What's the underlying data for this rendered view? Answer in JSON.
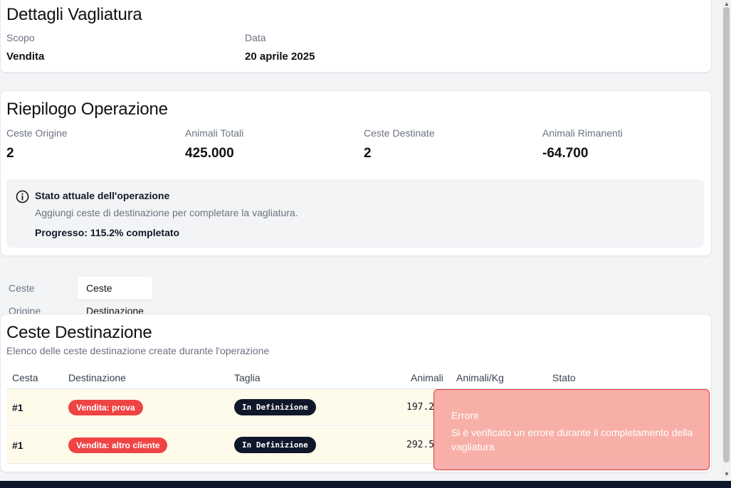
{
  "details": {
    "title": "Dettagli Vagliatura",
    "scope_label": "Scopo",
    "scope_value": "Vendita",
    "date_label": "Data",
    "date_value": "20 aprile 2025"
  },
  "summary": {
    "title": "Riepilogo Operazione",
    "stats": [
      {
        "label": "Ceste Origine",
        "value": "2"
      },
      {
        "label": "Animali Totali",
        "value": "425.000"
      },
      {
        "label": "Ceste Destinate",
        "value": "2"
      },
      {
        "label": "Animali Rimanenti",
        "value": "-64.700"
      }
    ],
    "info": {
      "icon": "info-icon",
      "title": "Stato attuale dell'operazione",
      "description": "Aggiungi ceste di destinazione per completare la vagliatura.",
      "progress": "Progresso: 115.2% completato"
    }
  },
  "tabs": [
    {
      "label": "Ceste Origine",
      "active": false
    },
    {
      "label": "Ceste Destinazione",
      "active": true
    }
  ],
  "destinations": {
    "title": "Ceste Destinazione",
    "subtitle": "Elenco delle ceste destinazione create durante l'operazione",
    "columns": [
      "Cesta",
      "Destinazione",
      "Taglia",
      "Animali",
      "Animali/Kg",
      "Stato"
    ],
    "rows": [
      {
        "cesta": "#1",
        "destinazione": "Vendita: prova",
        "taglia": "In Definizione",
        "animali": "197.2"
      },
      {
        "cesta": "#1",
        "destinazione": "Vendita: altro cliente",
        "taglia": "In Definizione",
        "animali": "292.5"
      }
    ]
  },
  "toast": {
    "title": "Errore",
    "message": "Si è verificato un errore durante il completamento della vagliatura"
  },
  "colors": {
    "badge_red": "#ef4444",
    "badge_dark": "#0f172a",
    "toast_bg": "#f4a19c",
    "row_bg": "#fffbeb"
  }
}
